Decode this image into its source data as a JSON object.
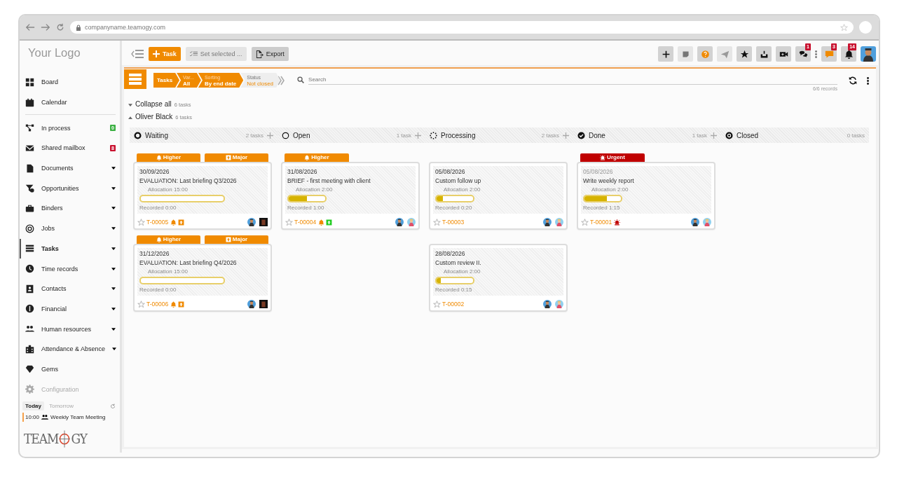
{
  "browser": {
    "url": "companyname.teamogy.com"
  },
  "logo_text": "Your Logo",
  "sidebar": {
    "sections": [
      {
        "items": [
          {
            "label": "Board",
            "selected": false,
            "disabled": false,
            "has_submenu": false
          },
          {
            "label": "Calendar",
            "selected": false,
            "disabled": false,
            "has_submenu": false
          }
        ]
      },
      {
        "items": [
          {
            "label": "In process",
            "selected": false,
            "disabled": false,
            "has_submenu": false,
            "badge": "0",
            "color": "#3cb043"
          },
          {
            "label": "Shared mailbox",
            "selected": false,
            "disabled": false,
            "has_submenu": false,
            "badge": "8",
            "color": "#c8102e"
          },
          {
            "label": "Documents",
            "selected": false,
            "disabled": false,
            "has_submenu": true
          },
          {
            "label": "Opportunities",
            "selected": false,
            "disabled": false,
            "has_submenu": true
          },
          {
            "label": "Binders",
            "selected": false,
            "disabled": false,
            "has_submenu": true
          },
          {
            "label": "Jobs",
            "selected": false,
            "disabled": false,
            "has_submenu": true
          },
          {
            "label": "Tasks",
            "selected": true,
            "disabled": false,
            "has_submenu": true
          },
          {
            "label": "Time records",
            "selected": false,
            "disabled": false,
            "has_submenu": true
          },
          {
            "label": "Contacts",
            "selected": false,
            "disabled": false,
            "has_submenu": true
          },
          {
            "label": "Financial",
            "selected": false,
            "disabled": false,
            "has_submenu": true
          },
          {
            "label": "Human resources",
            "selected": false,
            "disabled": false,
            "has_submenu": true
          },
          {
            "label": "Attendance & Absence",
            "selected": false,
            "disabled": false,
            "has_submenu": true
          },
          {
            "label": "Gems",
            "selected": false,
            "disabled": false,
            "has_submenu": false
          },
          {
            "label": "Configuration",
            "selected": false,
            "disabled": true,
            "has_submenu": false
          }
        ]
      }
    ]
  },
  "agenda": {
    "tabs": [
      {
        "label": "Today",
        "selected": true
      },
      {
        "label": "Tomorrow",
        "selected": false
      }
    ],
    "events": [
      {
        "time": "10:00",
        "title": "Weekly Team Meeting"
      }
    ]
  },
  "brand": {
    "before": "TEAM",
    "after": "GY"
  },
  "toolbar": {
    "task_button": "Task",
    "set_selected": "Set selected ...",
    "export_button": "Export"
  },
  "notifications": [
    {
      "badge": "1"
    },
    {
      "badge": "3"
    },
    {
      "badge": "14"
    }
  ],
  "breadcrumb": [
    {
      "value": "Tasks",
      "active": true
    },
    {
      "caption": "Var...",
      "value": "All",
      "active": true
    },
    {
      "caption": "Sorting",
      "value": "By end date",
      "active": true
    },
    {
      "caption": "Status",
      "value": "Not closed",
      "active": false
    }
  ],
  "search": {
    "placeholder": "Search"
  },
  "records": "6/6 records",
  "collapse_all": {
    "label": "Collapse all",
    "count": "6 tasks"
  },
  "group": {
    "name": "Oliver Black",
    "count": "6 tasks",
    "expanded": true
  },
  "columns": [
    {
      "kind": "waiting",
      "title": "Waiting",
      "count": "2 tasks",
      "addable": true,
      "cards": [
        {
          "tags": [
            {
              "label": "Higher",
              "kind": "bell",
              "color": "#f08a00"
            },
            {
              "label": "Major",
              "kind": "square",
              "color": "#f08a00"
            }
          ],
          "date": "30/09/2026",
          "title": "EVALUATION: Last briefing Q3/2026",
          "allocation": "Allocation 15:00",
          "wide_track": true,
          "level": 0,
          "recorded": "Recorded 0:00",
          "id": "T-00005",
          "starred": false,
          "flags": [
            {
              "kind": "bell",
              "color": "#f08a00"
            },
            {
              "kind": "square",
              "color": "#f08a00"
            }
          ],
          "assignees": [
            {
              "kind": "bearded"
            },
            {
              "kind": "dark"
            }
          ]
        },
        {
          "tags": [
            {
              "label": "Higher",
              "kind": "bell",
              "color": "#f08a00"
            },
            {
              "label": "Major",
              "kind": "square",
              "color": "#f08a00"
            }
          ],
          "date": "31/12/2026",
          "title": "EVALUATION: Last briefing Q4/2026",
          "allocation": "Allocation 15:00",
          "wide_track": true,
          "level": 0,
          "recorded": "Recorded 0:00",
          "id": "T-00006",
          "starred": false,
          "flags": [
            {
              "kind": "bell",
              "color": "#f08a00"
            },
            {
              "kind": "square",
              "color": "#f08a00"
            }
          ],
          "assignees": [
            {
              "kind": "bearded"
            },
            {
              "kind": "dark"
            }
          ]
        }
      ]
    },
    {
      "kind": "open",
      "title": "Open",
      "count": "1 task",
      "addable": true,
      "cards": [
        {
          "tags": [
            {
              "label": "Higher",
              "kind": "bell",
              "color": "#f08a00"
            }
          ],
          "date": "31/08/2026",
          "title": "BRIEF - first meeting with client",
          "allocation": "Allocation 2:00",
          "wide_track": false,
          "level": 0.5,
          "recorded": "Recorded 1:00",
          "id": "T-00004",
          "starred": false,
          "flags": [
            {
              "kind": "bell",
              "color": "#f08a00"
            },
            {
              "kind": "square",
              "color": "#22cc22"
            }
          ],
          "assignees": [
            {
              "kind": "bearded"
            },
            {
              "kind": "pink"
            }
          ]
        }
      ]
    },
    {
      "kind": "processing",
      "title": "Processing",
      "count": "2 tasks",
      "addable": true,
      "cards": [
        {
          "date": "05/08/2026",
          "title": "Custom follow up",
          "allocation": "Allocation 2:00",
          "wide_track": false,
          "level": 0.17,
          "recorded": "Recorded 0:20",
          "id": "T-00003",
          "starred": false,
          "assignees": [
            {
              "kind": "bearded"
            },
            {
              "kind": "pink"
            }
          ]
        },
        {
          "date": "28/08/2026",
          "title": "Custom review II.",
          "allocation": "Allocation 2:00",
          "wide_track": false,
          "level": 0.12,
          "recorded": "Recorded 0:15",
          "id": "T-00002",
          "starred": false,
          "assignees": [
            {
              "kind": "bearded"
            },
            {
              "kind": "pink"
            }
          ]
        }
      ]
    },
    {
      "kind": "done",
      "title": "Done",
      "count": "1 task",
      "addable": true,
      "cards": [
        {
          "tags": [
            {
              "label": "Urgent",
              "kind": "alarm",
              "color": "#c00000"
            }
          ],
          "date": "05/08/2026",
          "title": "Write weekly report",
          "allocation": "Allocation 2:00",
          "wide_track": false,
          "level": 0.62,
          "recorded": "Recorded 1:15",
          "id": "T-00001",
          "starred": false,
          "flags": [
            {
              "kind": "alarm",
              "color": "#c00000"
            }
          ],
          "assignees": [
            {
              "kind": "bearded"
            },
            {
              "kind": "pink"
            }
          ]
        }
      ]
    },
    {
      "kind": "closed",
      "title": "Closed",
      "count": "0 tasks",
      "addable": false
    }
  ]
}
